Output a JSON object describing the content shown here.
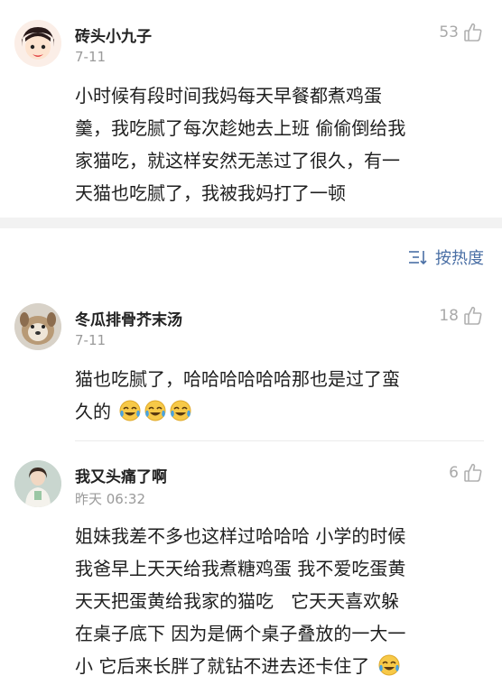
{
  "comments": [
    {
      "name": "砖头小九子",
      "date": "7-11",
      "likes": "53",
      "lines": [
        "小时候有段时间我妈每天早餐都煮鸡蛋",
        "羹，我吃腻了每次趁她去上班 偷偷倒给我",
        "家猫吃，就这样安然无恙过了很久，有一",
        "天猫也吃腻了，我被我妈打了一顿"
      ]
    },
    {
      "name": "冬瓜排骨芥末汤",
      "date": "7-11",
      "likes": "18",
      "lines": [
        "猫也吃腻了，哈哈哈哈哈哈那也是过了蛮",
        "久的"
      ],
      "emoji_count": 3
    },
    {
      "name": "我又头痛了啊",
      "date": "昨天 06:32",
      "likes": "6",
      "lines": [
        "姐妹我差不多也这样过哈哈哈 小学的时候",
        "我爸早上天天给我煮糖鸡蛋 我不爱吃蛋黄",
        "天天把蛋黄给我家的猫吃   它天天喜欢躲",
        "在桌子底下 因为是俩个桌子叠放的一大一",
        "小 它后来长胖了就钻不进去还卡住了"
      ],
      "emoji_count": 1
    }
  ],
  "sort": {
    "label": "按热度",
    "icon": "sort-icon"
  },
  "colors": {
    "link": "#4a6fa5",
    "muted": "#9a9a9a",
    "divider": "#f2f2f2"
  }
}
